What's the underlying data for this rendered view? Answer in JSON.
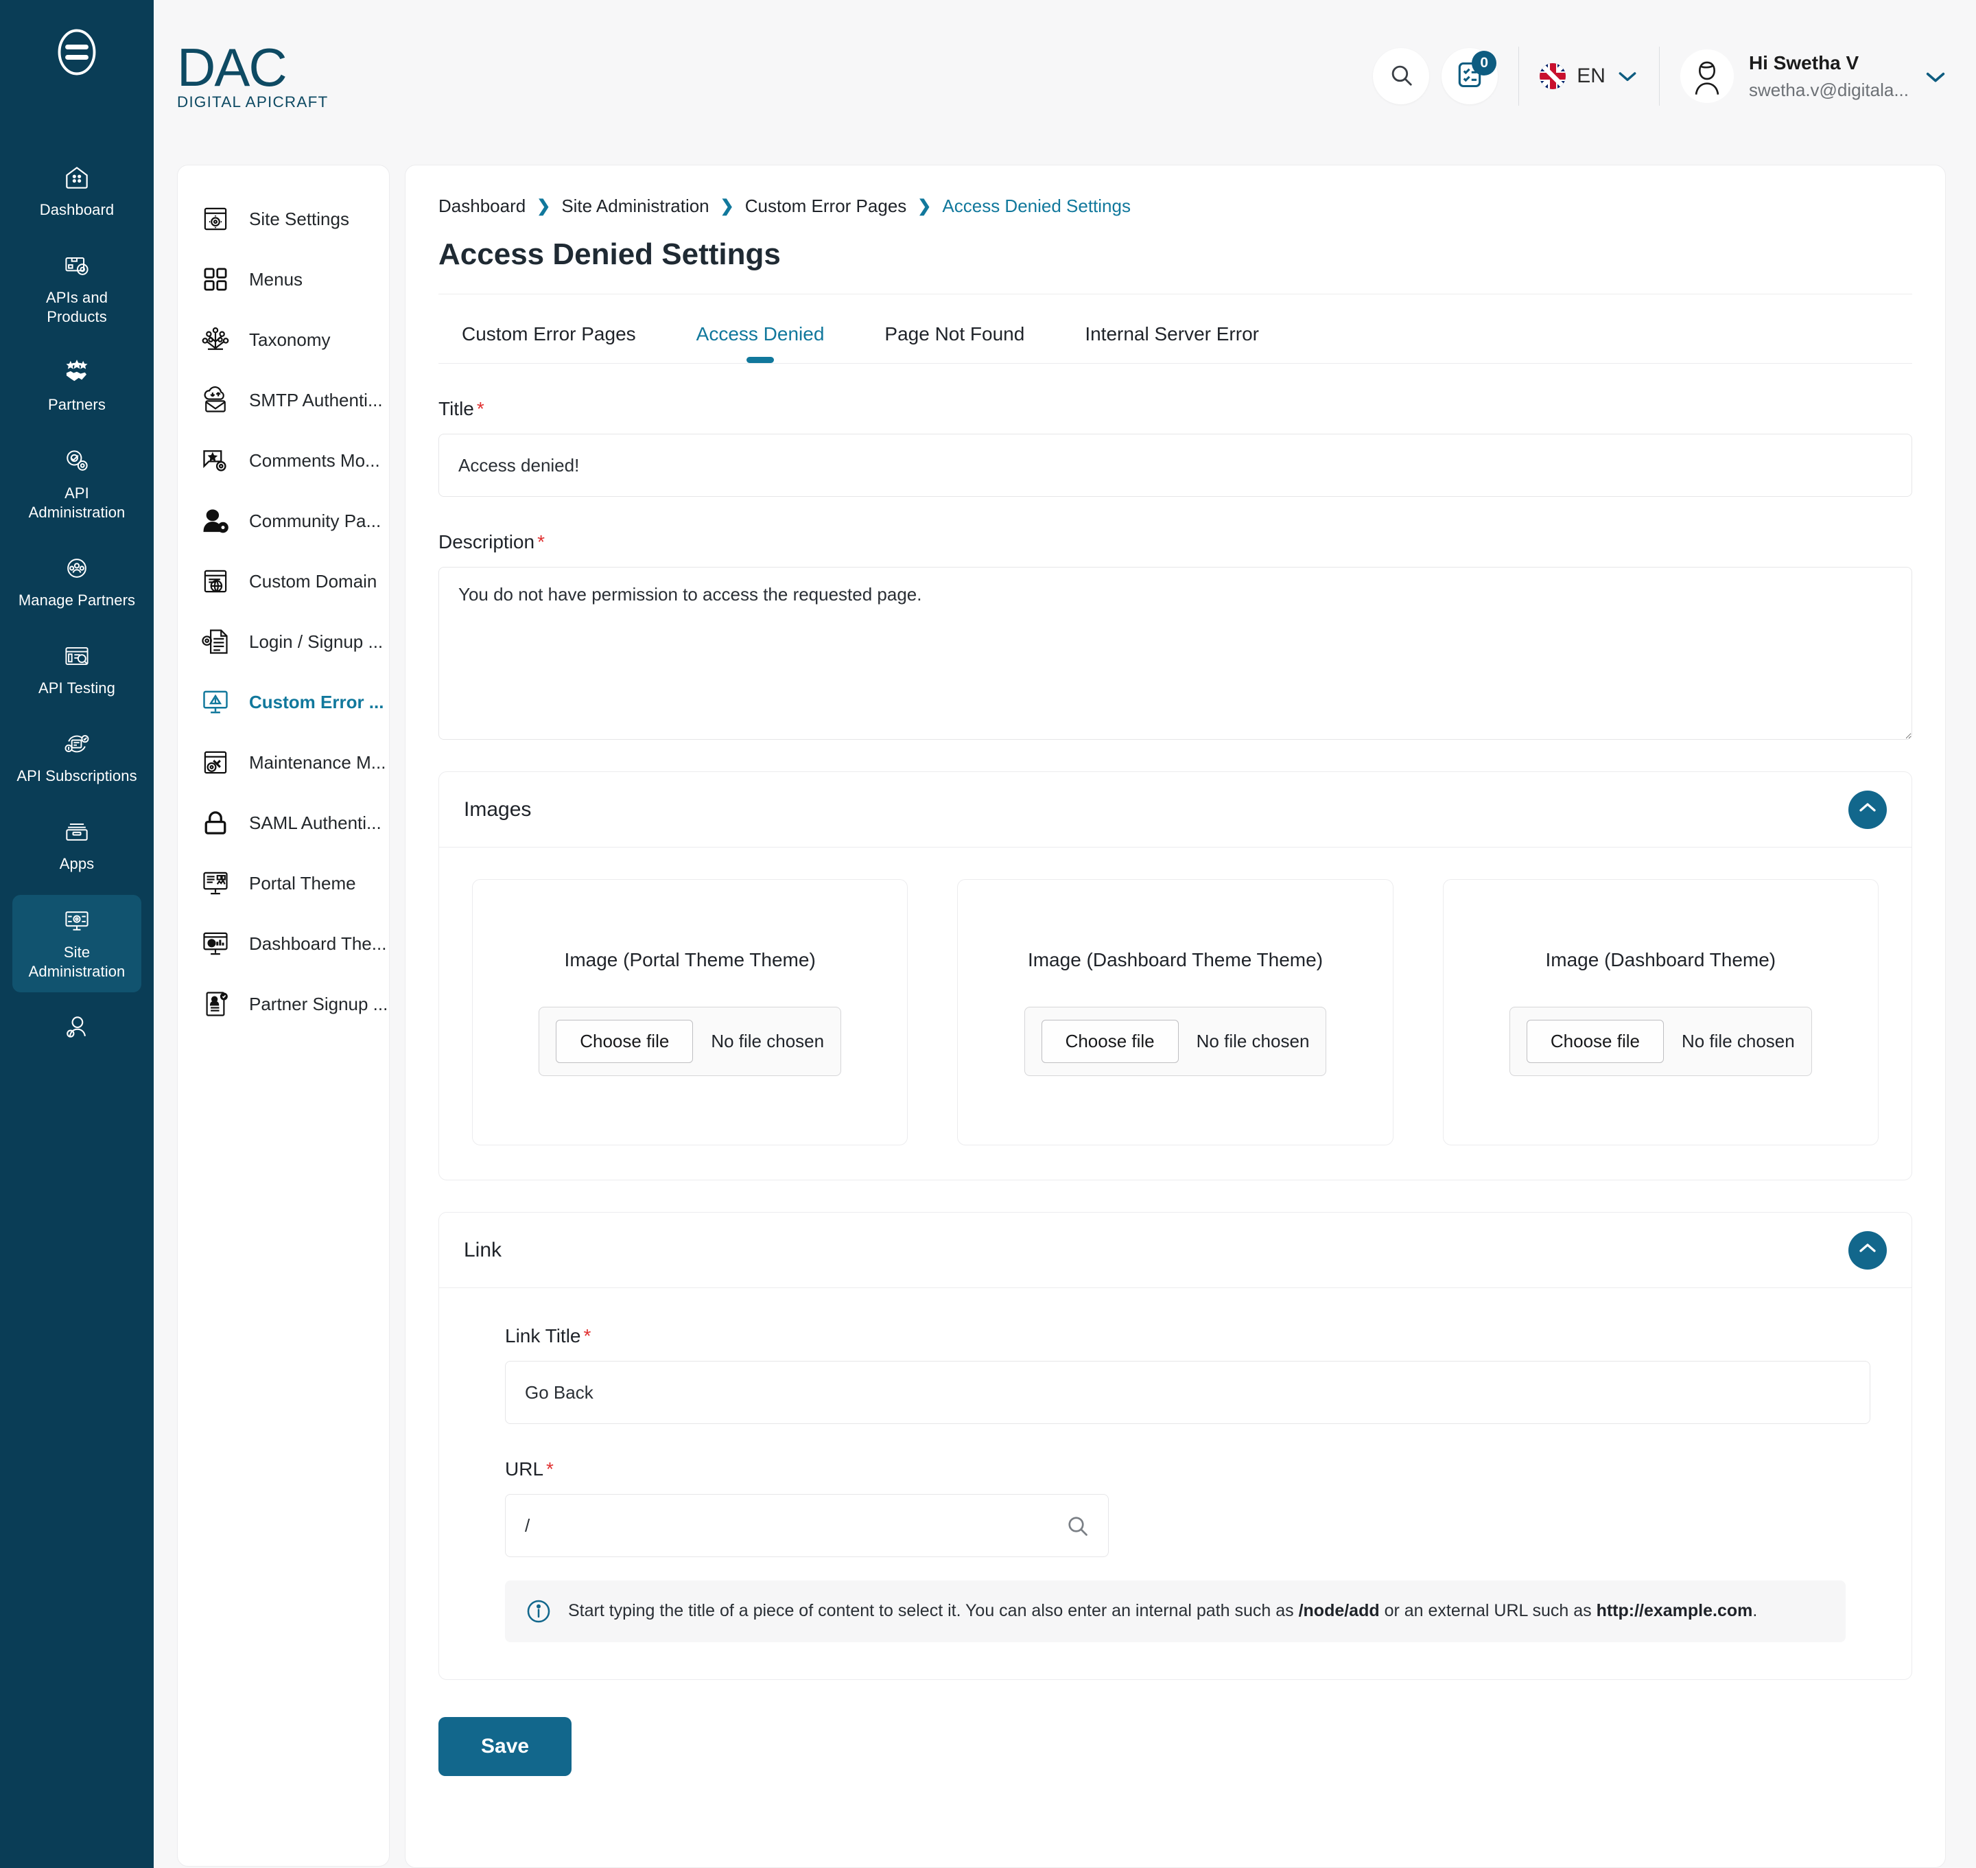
{
  "brand": {
    "name": "DAC",
    "tagline": "DIGITAL APICRAFT"
  },
  "header": {
    "search_icon": "search-icon",
    "tasks_icon": "tasks-icon",
    "tasks_badge": "0",
    "language": "EN",
    "language_flag": "uk-flag-icon",
    "user_greeting": "Hi Swetha V",
    "user_email": "swetha.v@digitala..."
  },
  "rail": {
    "menu_icon": "hamburger-menu-icon",
    "items": [
      {
        "label": "Dashboard",
        "icon": "home-icon",
        "active": false
      },
      {
        "label": "APIs and Products",
        "icon": "api-products-icon",
        "active": false
      },
      {
        "label": "Partners",
        "icon": "partners-handshake-icon",
        "active": false
      },
      {
        "label": "API Administration",
        "icon": "api-admin-gear-icon",
        "active": false
      },
      {
        "label": "Manage Partners",
        "icon": "manage-partners-icon",
        "active": false
      },
      {
        "label": "API Testing",
        "icon": "api-testing-icon",
        "active": false
      },
      {
        "label": "API Subscriptions",
        "icon": "api-subscriptions-icon",
        "active": false
      },
      {
        "label": "Apps",
        "icon": "apps-box-icon",
        "active": false
      },
      {
        "label": "Site Administration",
        "icon": "site-administration-icon",
        "active": true
      },
      {
        "label": "",
        "icon": "user-settings-icon",
        "active": false
      }
    ]
  },
  "subnav": {
    "items": [
      {
        "label": "Site Settings",
        "icon": "site-settings-icon",
        "active": false
      },
      {
        "label": "Menus",
        "icon": "menus-grid-icon",
        "active": false
      },
      {
        "label": "Taxonomy",
        "icon": "taxonomy-tree-icon",
        "active": false
      },
      {
        "label": "SMTP Authenti...",
        "icon": "smtp-mail-cloud-icon",
        "active": false
      },
      {
        "label": "Comments Mo...",
        "icon": "comments-moderation-icon",
        "active": false
      },
      {
        "label": "Community Pa...",
        "icon": "community-user-gear-icon",
        "active": false
      },
      {
        "label": "Custom Domain",
        "icon": "custom-domain-globe-icon",
        "active": false
      },
      {
        "label": "Login / Signup ...",
        "icon": "login-signup-doc-icon",
        "active": false
      },
      {
        "label": "Custom Error ...",
        "icon": "custom-error-pages-icon",
        "active": true
      },
      {
        "label": "Maintenance M...",
        "icon": "maintenance-mode-icon",
        "active": false
      },
      {
        "label": "SAML Authenti...",
        "icon": "saml-lock-icon",
        "active": false
      },
      {
        "label": "Portal Theme",
        "icon": "portal-theme-icon",
        "active": false
      },
      {
        "label": "Dashboard The...",
        "icon": "dashboard-theme-icon",
        "active": false
      },
      {
        "label": "Partner Signup ...",
        "icon": "partner-signup-icon",
        "active": false
      }
    ]
  },
  "breadcrumb": [
    {
      "label": "Dashboard",
      "current": false
    },
    {
      "label": "Site Administration",
      "current": false
    },
    {
      "label": "Custom Error Pages",
      "current": false
    },
    {
      "label": "Access Denied Settings",
      "current": true
    }
  ],
  "page": {
    "title": "Access Denied Settings"
  },
  "tabs": [
    {
      "label": "Custom Error Pages",
      "active": false
    },
    {
      "label": "Access Denied",
      "active": true
    },
    {
      "label": "Page Not Found",
      "active": false
    },
    {
      "label": "Internal Server Error",
      "active": false
    }
  ],
  "form": {
    "title_label": "Title",
    "title_value": "Access denied!",
    "description_label": "Description",
    "description_value": "You do not have permission to access the requested page.",
    "required_mark": "*"
  },
  "images_panel": {
    "title": "Images",
    "collapse_icon": "chevron-up-icon",
    "cards": [
      {
        "title": "Image (Portal Theme Theme)",
        "button": "Choose file",
        "status": "No file chosen"
      },
      {
        "title": "Image (Dashboard Theme Theme)",
        "button": "Choose file",
        "status": "No file chosen"
      },
      {
        "title": "Image (Dashboard Theme)",
        "button": "Choose file",
        "status": "No file chosen"
      }
    ]
  },
  "link_panel": {
    "title": "Link",
    "collapse_icon": "chevron-up-icon",
    "link_title_label": "Link Title",
    "link_title_value": "Go Back",
    "url_label": "URL",
    "url_value": "/",
    "url_search_icon": "search-icon",
    "hint_icon": "info-icon",
    "hint_part1": "Start typing the title of a piece of content to select it. You can also enter an internal path such as",
    "hint_code1": "/node/add",
    "hint_part2": "or an external URL such as",
    "hint_code2": "http://example.com",
    "hint_part3": "."
  },
  "footer": {
    "save_label": "Save"
  },
  "colors": {
    "rail_bg": "#0a3d56",
    "accent": "#11789c",
    "button": "#12678c",
    "required": "#e03131",
    "page_bg": "#f7f7f8"
  }
}
